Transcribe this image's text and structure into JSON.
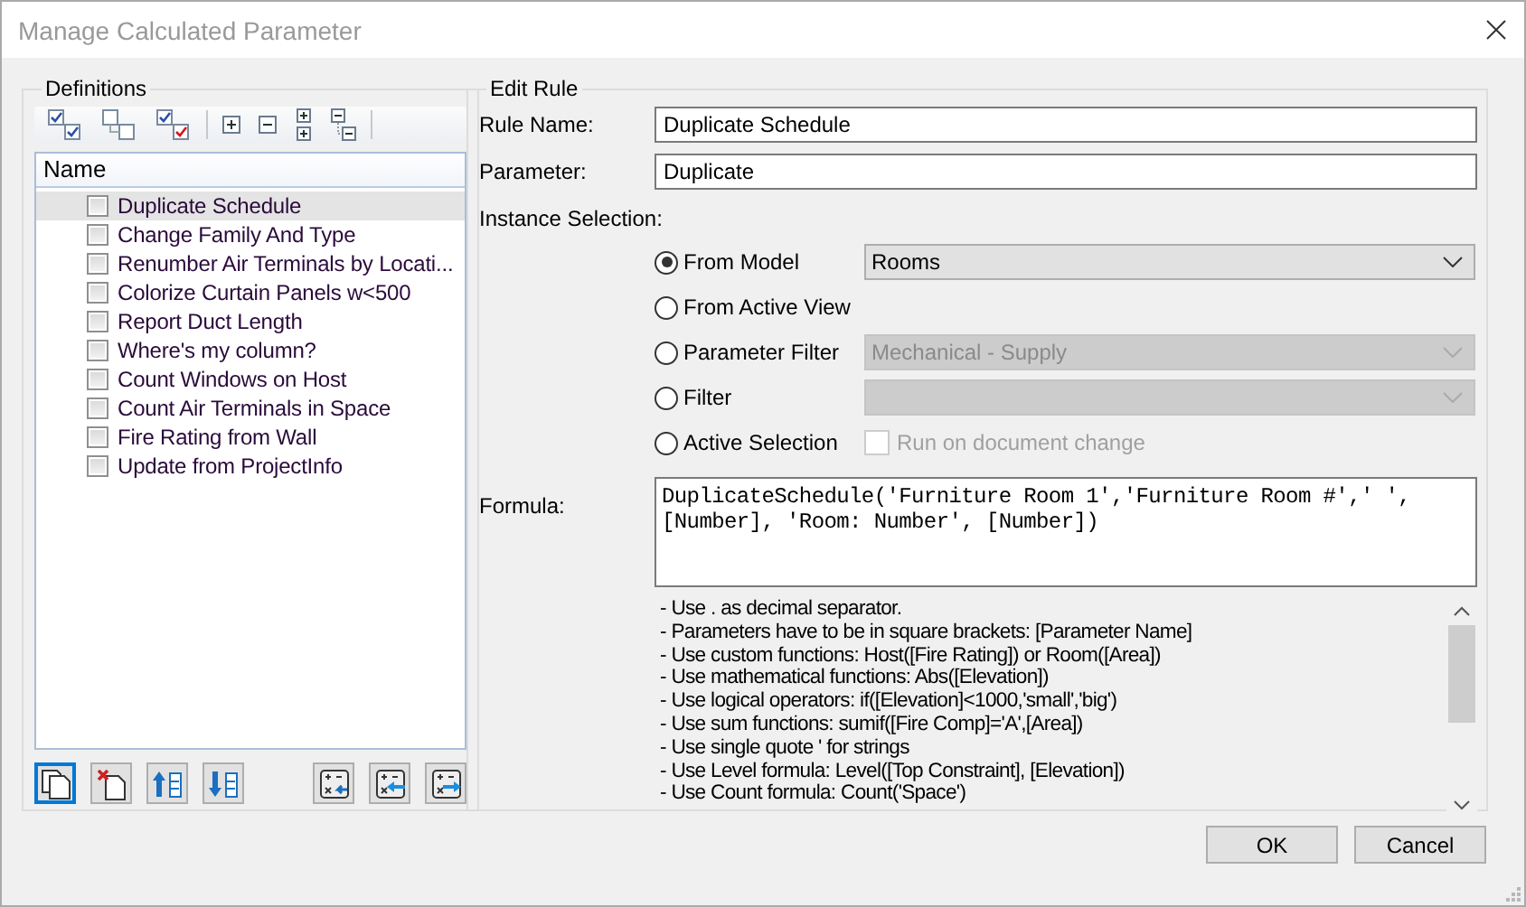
{
  "window": {
    "title": "Manage Calculated Parameter"
  },
  "definitions": {
    "legend": "Definitions",
    "column": "Name",
    "items": [
      {
        "label": "Duplicate Schedule",
        "checked": false,
        "selected": true
      },
      {
        "label": "Change Family And Type",
        "checked": false,
        "selected": false
      },
      {
        "label": "Renumber Air Terminals by Locati...",
        "checked": false,
        "selected": false
      },
      {
        "label": "Colorize Curtain Panels w<500",
        "checked": false,
        "selected": false
      },
      {
        "label": "Report Duct Length",
        "checked": false,
        "selected": false
      },
      {
        "label": "Where's my column?",
        "checked": false,
        "selected": false
      },
      {
        "label": "Count Windows on Host",
        "checked": false,
        "selected": false
      },
      {
        "label": "Count Air Terminals in Space",
        "checked": false,
        "selected": false
      },
      {
        "label": "Fire Rating from Wall",
        "checked": false,
        "selected": false
      },
      {
        "label": "Update from ProjectInfo",
        "checked": false,
        "selected": false
      }
    ]
  },
  "edit_rule": {
    "legend": "Edit Rule",
    "rule_name": {
      "label": "Rule Name:",
      "value": "Duplicate Schedule"
    },
    "parameter": {
      "label": "Parameter:",
      "value": "Duplicate"
    },
    "instance_selection": {
      "label": "Instance Selection:",
      "options": [
        {
          "label": "From Model",
          "selected": true,
          "kind": "dropdown",
          "dropdown": {
            "value": "Rooms",
            "disabled": false
          }
        },
        {
          "label": "From Active View",
          "selected": false,
          "kind": "none"
        },
        {
          "label": "Parameter Filter",
          "selected": false,
          "kind": "dropdown",
          "dropdown": {
            "value": "Mechanical - Supply",
            "disabled": true
          }
        },
        {
          "label": "Filter",
          "selected": false,
          "kind": "dropdown",
          "dropdown": {
            "disabled": true
          }
        },
        {
          "label": "Active Selection",
          "selected": false,
          "kind": "checkbox",
          "checkbox": {
            "label": "Run on document change",
            "checked": false,
            "disabled": true
          }
        }
      ]
    },
    "formula": {
      "label": "Formula:",
      "value": "DuplicateSchedule('Furniture Room 1','Furniture Room #',' ',\n[Number], 'Room: Number', [Number])"
    },
    "help": [
      "- Use . as decimal separator.",
      "- Parameters have to be in square brackets: [Parameter Name]",
      "- Use custom functions: Host([Fire Rating]) or Room([Area])",
      "- Use mathematical functions: Abs([Elevation])",
      "- Use logical operators: if([Elevation]<1000,'small','big')",
      "- Use sum functions: sumif([Fire Comp]='A',[Area])",
      "- Use single quote ' for strings",
      "- Use Level formula: Level([Top Constraint], [Elevation])",
      "- Use Count formula: Count('Space')"
    ]
  },
  "buttons": [
    "OK",
    "Cancel"
  ]
}
